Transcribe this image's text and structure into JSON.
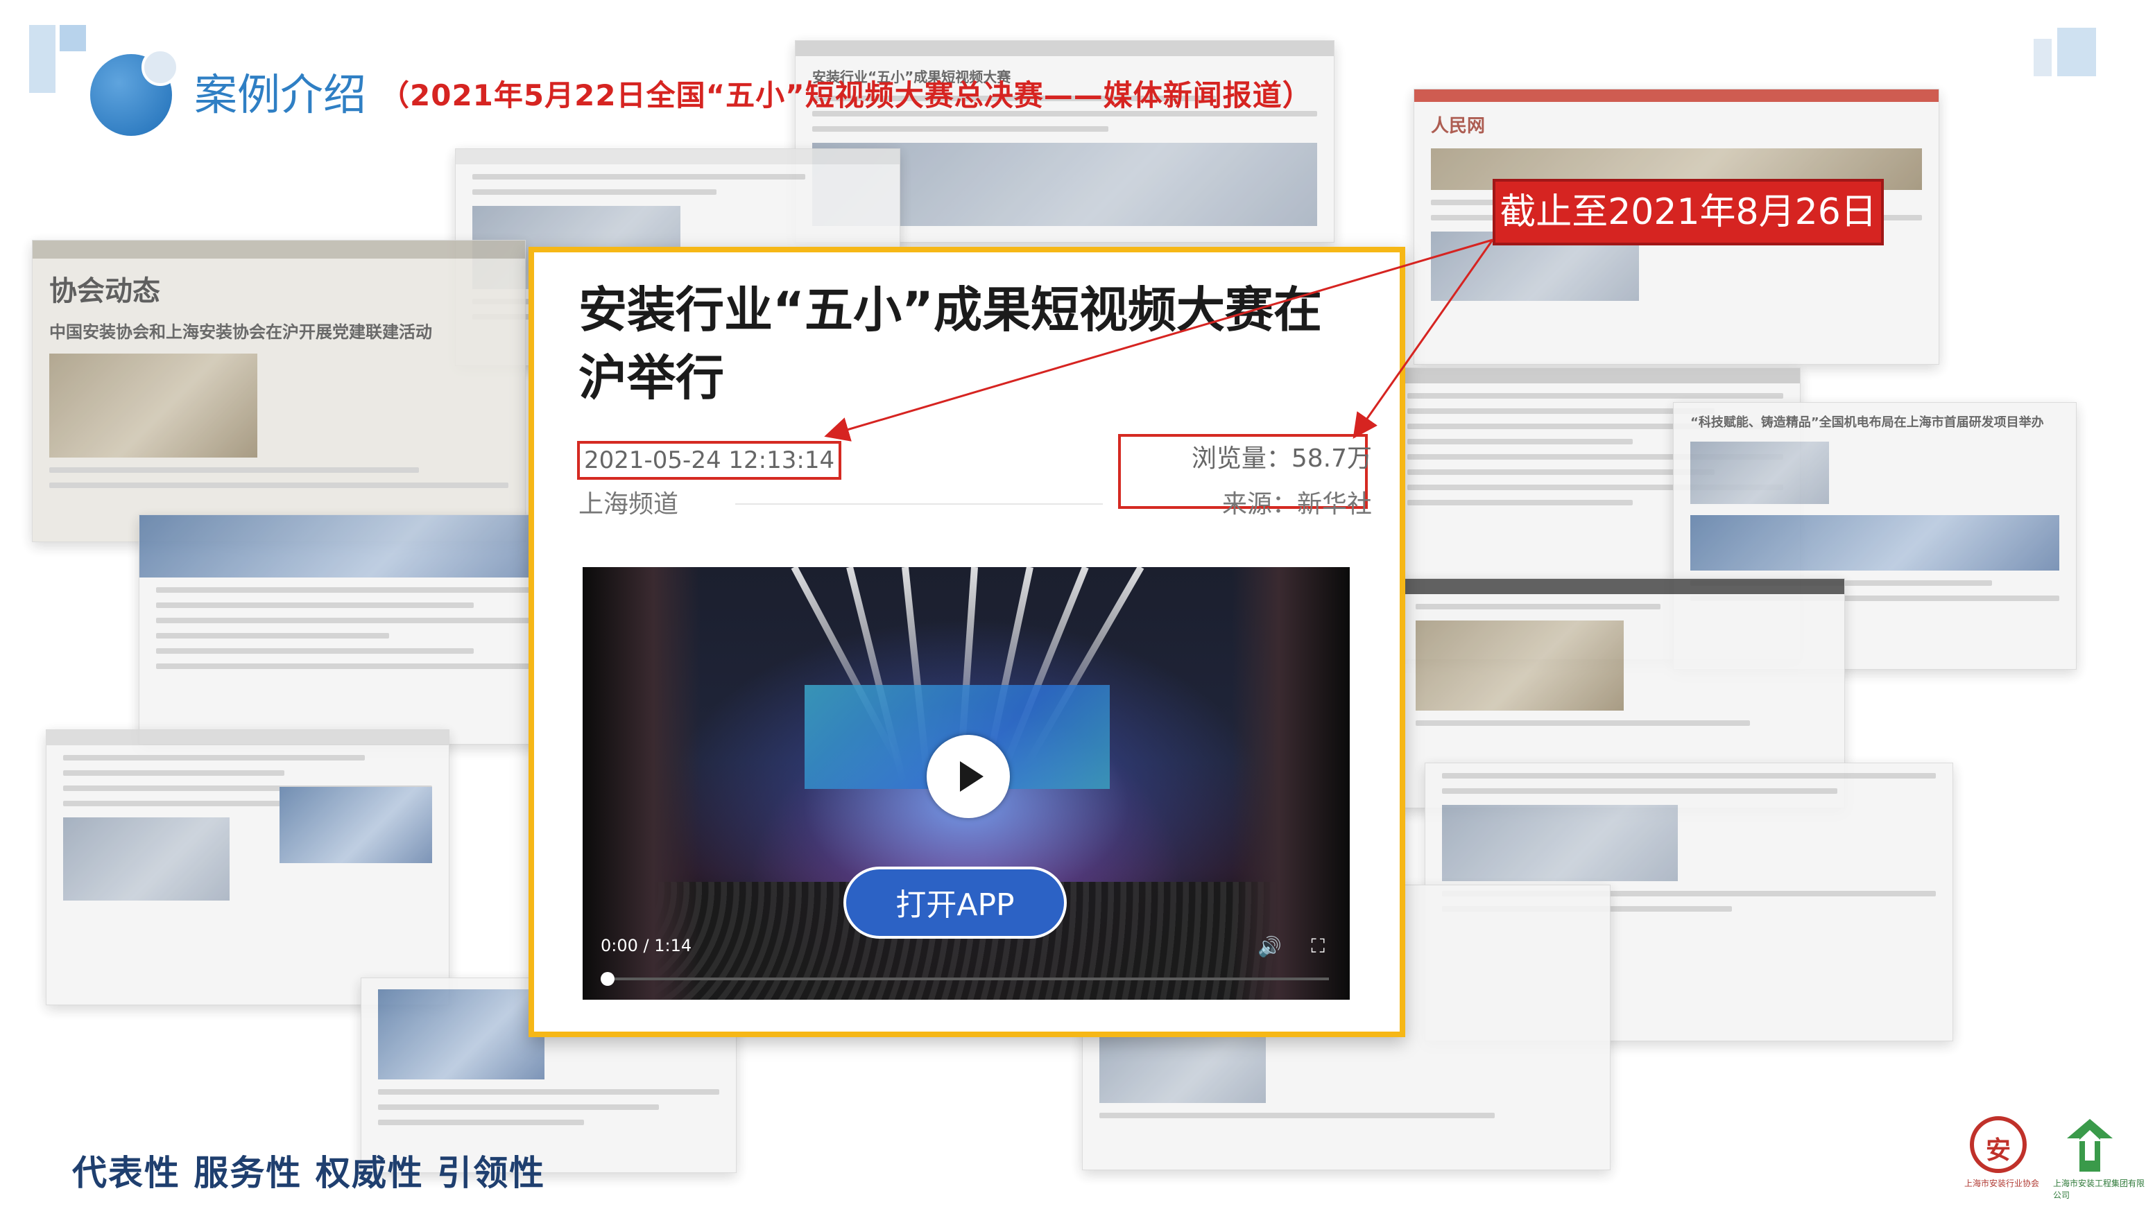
{
  "header": {
    "title": "案例介绍",
    "subtitle": "（2021年5月22日全国“五小”短视频大赛总决赛——媒体新闻报道）"
  },
  "background_clippings": [
    {
      "headline": "协会动态",
      "subline": "中国安装协会和上海安装协会在沪开展党建联建活动"
    },
    {
      "headline": "安装行业“五小”成果短视频大赛"
    },
    {
      "headline": "“科技赋能、铸造精品”全国机电布局在上海市首届研发项目举办"
    },
    {
      "headline": "人民网"
    }
  ],
  "featured_article": {
    "title": "安装行业“五小”成果短视频大赛在沪举行",
    "datetime": "2021-05-24 12:13:14",
    "views": "浏览量：58.7万",
    "channel": "上海频道",
    "source": "来源：新华社",
    "video": {
      "current_time": "0:00",
      "duration": "1:14",
      "time_display": "0:00 / 1:14",
      "progress": 0.0,
      "open_app_label": "打开APP",
      "volume_icon": "volume-icon",
      "fullscreen_icon": "fullscreen-icon",
      "play_icon": "play-icon"
    }
  },
  "callout": {
    "text": "截止至2021年8月26日"
  },
  "footer": {
    "slogan": "代表性 服务性 权威性 引领性",
    "logo1_caption": "上海市安装行业协会",
    "logo2_caption": "上海市安装工程集团有限公司"
  },
  "colors": {
    "title_blue": "#2f7fc4",
    "subtitle_red": "#d62421",
    "frame_gold": "#f6b716",
    "highlight_red": "#d52a22",
    "button_blue": "#2c62c5",
    "slogan_navy": "#1f3f6f"
  }
}
